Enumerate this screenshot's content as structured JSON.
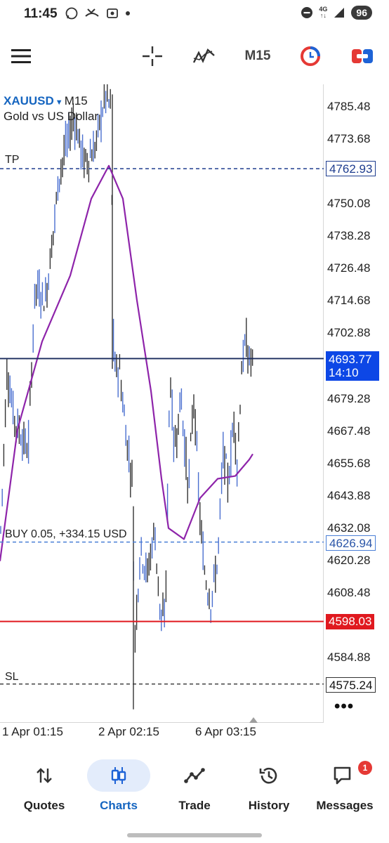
{
  "status": {
    "time": "11:45",
    "network": "4G",
    "battery": "96"
  },
  "toolbar": {
    "timeframe": "M15"
  },
  "chart": {
    "symbol": "XAUUSD",
    "timeframe": "M15",
    "description": "Gold vs US Dollar",
    "price_scale": [
      "4785.48",
      "4773.68",
      "4750.08",
      "4738.28",
      "4726.48",
      "4714.68",
      "4702.88",
      "4679.28",
      "4667.48",
      "4655.68",
      "4643.88",
      "4632.08",
      "4620.28",
      "4608.48",
      "4584.88"
    ],
    "tp": {
      "label": "TP",
      "price": "4762.93"
    },
    "bid": {
      "price": "4693.77",
      "countdown": "14:10"
    },
    "position": {
      "label": "BUY 0.05,  +334.15 USD",
      "price": "4626.94"
    },
    "red_level": {
      "price": "4598.03"
    },
    "sl": {
      "label": "SL",
      "price": "4575.24"
    },
    "time_axis": [
      "1 Apr 01:15",
      "2 Apr 02:15",
      "6 Apr 03:15"
    ],
    "colors": {
      "up": "#4a6fd0",
      "down": "#333333",
      "ma": "#8e24aa",
      "tp_line": "#1e3d8f",
      "position_line": "#4a7fd6",
      "red_line": "#e0191f",
      "bid_line": "#1a2b5c"
    }
  },
  "nav": {
    "items": [
      {
        "label": "Quotes",
        "icon": "arrows-updown-icon"
      },
      {
        "label": "Charts",
        "icon": "candles-icon"
      },
      {
        "label": "Trade",
        "icon": "trade-line-icon"
      },
      {
        "label": "History",
        "icon": "history-icon"
      },
      {
        "label": "Messages",
        "icon": "chat-icon"
      }
    ],
    "active": "Charts",
    "messages_badge": "1"
  }
}
